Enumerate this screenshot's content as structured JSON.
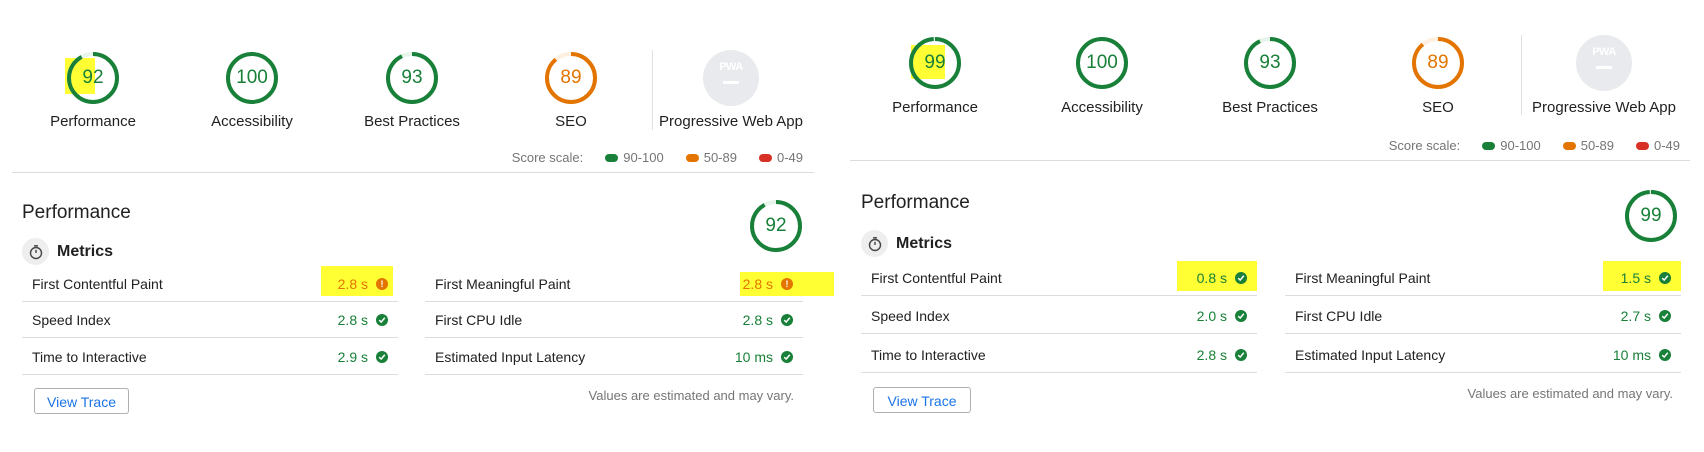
{
  "colors": {
    "pass": "#188038",
    "average": "#e37400",
    "fail": "#d93025",
    "highlight": "#ffff33",
    "link": "#1a73e8",
    "pwa_badge": "#e8eaed"
  },
  "reports": [
    {
      "categories": [
        {
          "label": "Performance",
          "score": "92",
          "status": "pass",
          "highlighted": true
        },
        {
          "label": "Accessibility",
          "score": "100",
          "status": "pass"
        },
        {
          "label": "Best Practices",
          "score": "93",
          "status": "pass"
        },
        {
          "label": "SEO",
          "score": "89",
          "status": "average"
        }
      ],
      "pwa": {
        "label": "Progressive Web App",
        "badge_text": "PWA",
        "icon": "pwa-badge-icon"
      },
      "score_scale": {
        "label": "Score scale:",
        "ranges": [
          "90-100",
          "50-89",
          "0-49"
        ]
      },
      "performance": {
        "title": "Performance",
        "score": "92",
        "metrics_title": "Metrics",
        "metrics": [
          {
            "label": "First Contentful Paint",
            "value": "2.8 s",
            "status": "average",
            "highlighted": true
          },
          {
            "label": "First Meaningful Paint",
            "value": "2.8 s",
            "status": "average",
            "highlighted": true
          },
          {
            "label": "Speed Index",
            "value": "2.8 s",
            "status": "pass"
          },
          {
            "label": "First CPU Idle",
            "value": "2.8 s",
            "status": "pass"
          },
          {
            "label": "Time to Interactive",
            "value": "2.9 s",
            "status": "pass"
          },
          {
            "label": "Estimated Input Latency",
            "value": "10 ms",
            "status": "pass"
          }
        ],
        "view_trace": "View Trace",
        "note": "Values are estimated and may vary."
      }
    },
    {
      "categories": [
        {
          "label": "Performance",
          "score": "99",
          "status": "pass",
          "highlighted": true
        },
        {
          "label": "Accessibility",
          "score": "100",
          "status": "pass"
        },
        {
          "label": "Best Practices",
          "score": "93",
          "status": "pass"
        },
        {
          "label": "SEO",
          "score": "89",
          "status": "average"
        }
      ],
      "pwa": {
        "label": "Progressive Web App",
        "badge_text": "PWA",
        "icon": "pwa-badge-icon"
      },
      "score_scale": {
        "label": "Score scale:",
        "ranges": [
          "90-100",
          "50-89",
          "0-49"
        ]
      },
      "performance": {
        "title": "Performance",
        "score": "99",
        "metrics_title": "Metrics",
        "metrics": [
          {
            "label": "First Contentful Paint",
            "value": "0.8 s",
            "status": "pass",
            "highlighted": true
          },
          {
            "label": "First Meaningful Paint",
            "value": "1.5 s",
            "status": "pass",
            "highlighted": true
          },
          {
            "label": "Speed Index",
            "value": "2.0 s",
            "status": "pass"
          },
          {
            "label": "First CPU Idle",
            "value": "2.7 s",
            "status": "pass"
          },
          {
            "label": "Time to Interactive",
            "value": "2.8 s",
            "status": "pass"
          },
          {
            "label": "Estimated Input Latency",
            "value": "10 ms",
            "status": "pass"
          }
        ],
        "view_trace": "View Trace",
        "note": "Values are estimated and may vary."
      }
    }
  ]
}
